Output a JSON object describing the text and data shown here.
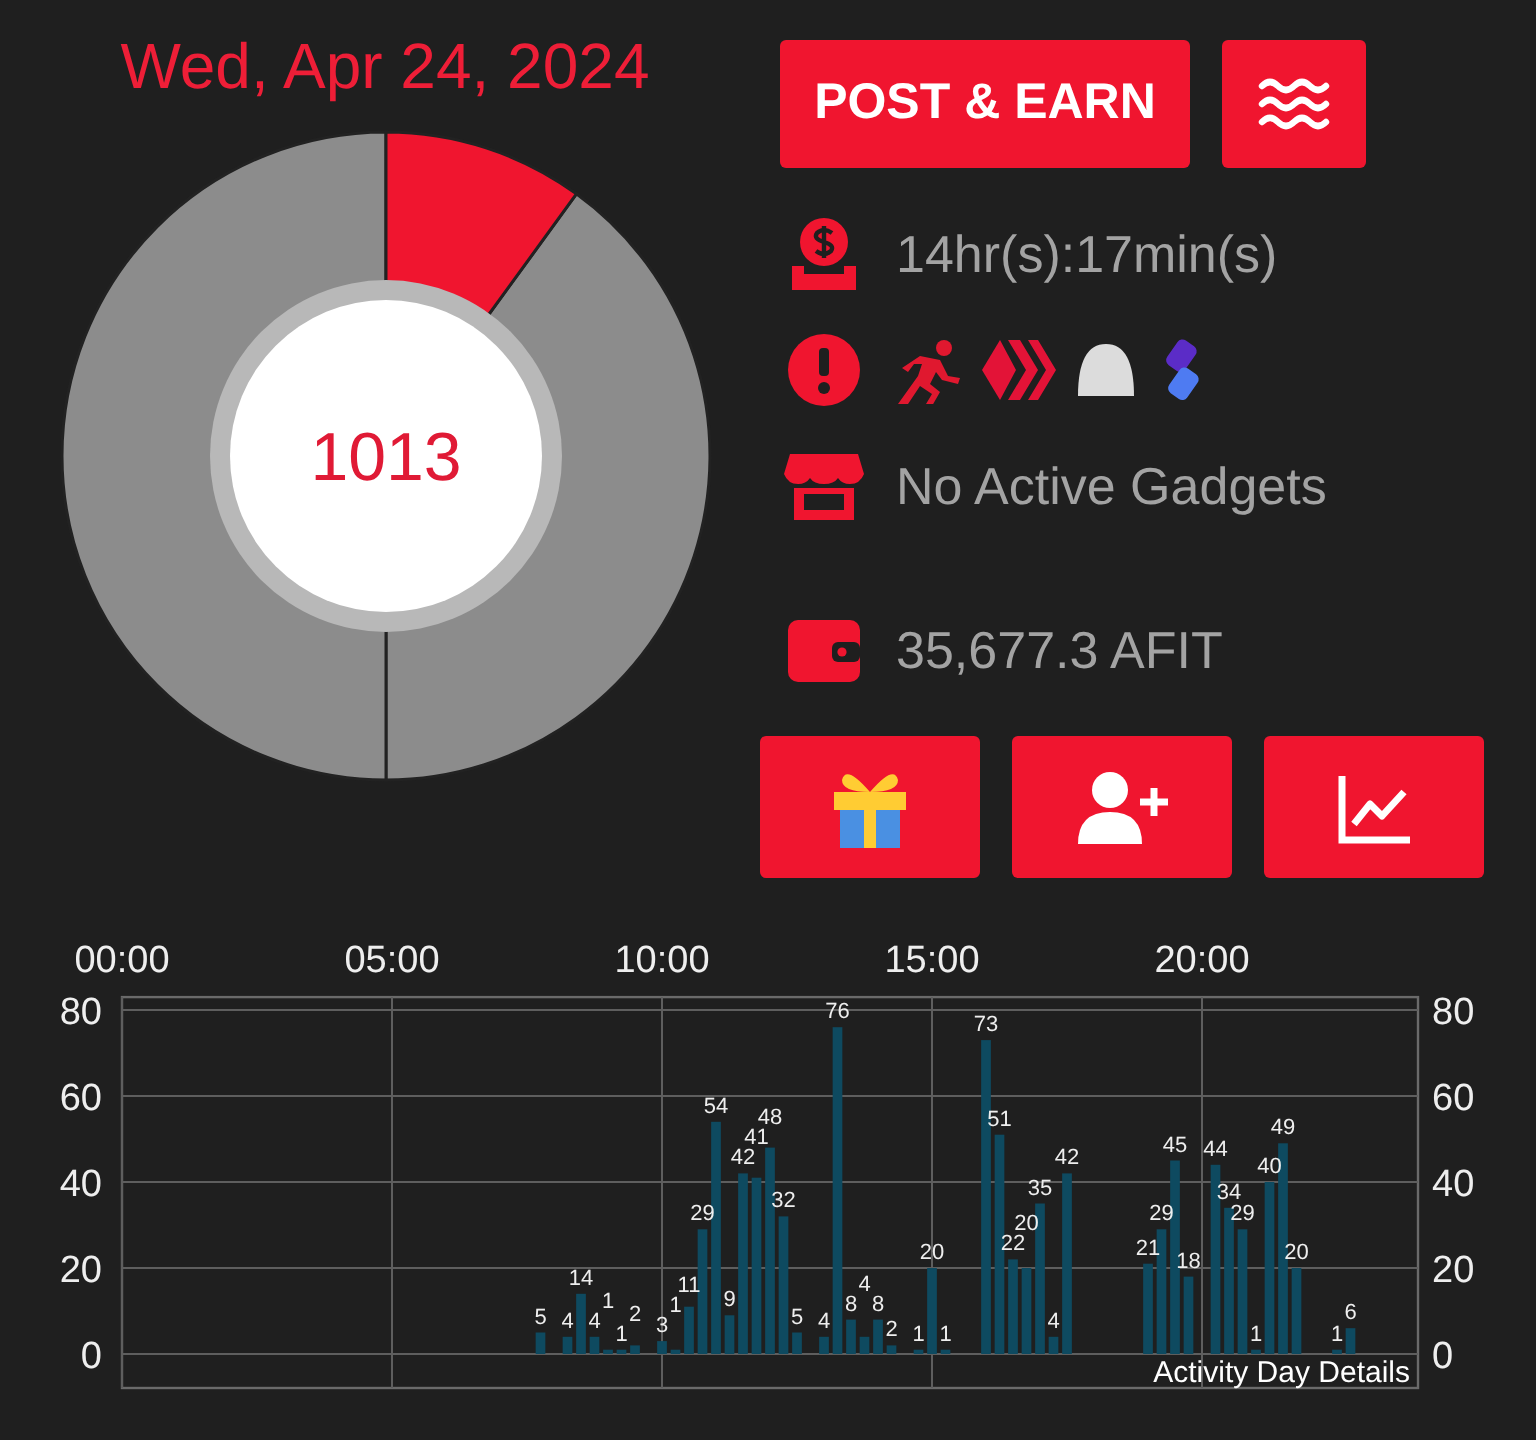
{
  "date": "Wed, Apr 24, 2024",
  "steps": {
    "count": "1013"
  },
  "post_button": "POST & EARN",
  "info_rows": [
    {
      "kind": "timer",
      "text": "14hr(s):17min(s)"
    },
    {
      "kind": "status"
    },
    {
      "kind": "gadgets",
      "text": "No Active Gadgets"
    },
    {
      "kind": "balance",
      "text": "35,677.3 AFIT"
    }
  ],
  "action_buttons": [
    {
      "kind": "gift"
    },
    {
      "kind": "add-user"
    },
    {
      "kind": "chart"
    }
  ],
  "chart_data": {
    "type": "bar",
    "title": "Activity Day Details",
    "data_labels": true,
    "xlim": [
      0,
      24
    ],
    "ylim": [
      0,
      83
    ],
    "xticks": [
      {
        "value": 0,
        "label": "00:00"
      },
      {
        "value": 5,
        "label": "05:00"
      },
      {
        "value": 10,
        "label": "10:00"
      },
      {
        "value": 15,
        "label": "15:00"
      },
      {
        "value": 20,
        "label": "20:00"
      }
    ],
    "grid": true,
    "yticks": [
      0,
      20,
      40,
      60,
      80
    ],
    "y2ticks": [
      0,
      20,
      40,
      60,
      80
    ],
    "y2lim": [
      0,
      83
    ],
    "x": [
      7.75,
      8.25,
      8.5,
      8.75,
      9,
      9.25,
      9.5,
      10,
      10.25,
      10.5,
      10.75,
      11,
      11.25,
      11.5,
      11.75,
      12,
      12.25,
      12.5,
      13,
      13.25,
      13.5,
      13.75,
      14,
      14.25,
      14.75,
      15,
      15.25,
      16,
      16.25,
      16.5,
      16.75,
      17,
      17.25,
      17.5,
      19,
      19.25,
      19.5,
      19.75,
      20.25,
      20.5,
      20.75,
      21,
      21.25,
      21.5,
      21.75,
      22.5,
      22.75
    ],
    "values": [
      5,
      4,
      14,
      4,
      1,
      1,
      2,
      3,
      1,
      11,
      29,
      54,
      9,
      42,
      41,
      48,
      32,
      5,
      4,
      76,
      8,
      4,
      8,
      2,
      1,
      20,
      1,
      73,
      51,
      22,
      20,
      35,
      4,
      42,
      21,
      29,
      45,
      18,
      44,
      34,
      29,
      1,
      40,
      49,
      20,
      1,
      6
    ]
  }
}
